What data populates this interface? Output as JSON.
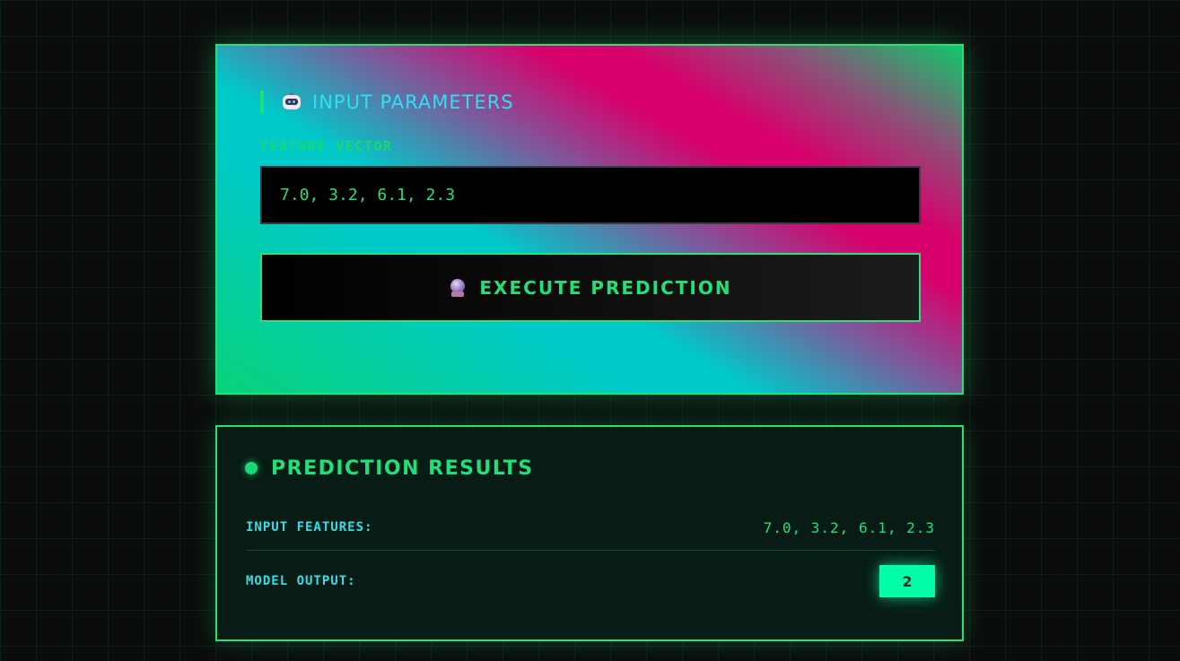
{
  "input_panel": {
    "title": "INPUT PARAMETERS",
    "title_icon": "robot-icon",
    "feature_label": "FEATURE VECTOR",
    "feature_value": "7.0, 3.2, 6.1, 2.3",
    "execute_label": "EXECUTE PREDICTION",
    "execute_icon": "crystal-ball-icon"
  },
  "results_panel": {
    "title": "PREDICTION RESULTS",
    "input_features_label": "INPUT FEATURES:",
    "input_features_value": "7.0, 3.2, 6.1, 2.3",
    "model_output_label": "MODEL OUTPUT:",
    "model_output_value": "2"
  },
  "colors": {
    "accent_green": "#22e27a",
    "accent_cyan": "#2fe0f0",
    "accent_pink": "#d8006c",
    "badge_green": "#00ffa8",
    "background": "#0b0d0c"
  }
}
